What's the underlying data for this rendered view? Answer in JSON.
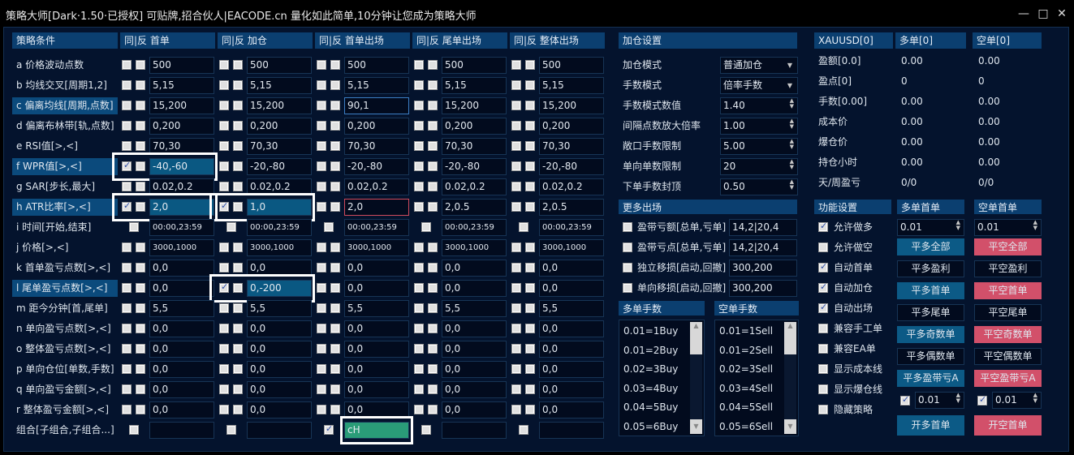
{
  "title": "策略大师[Dark·1.50·已授权]  可贴牌,招合伙人|EACODE.cn  量化如此简单,10分钟让您成为策略大师",
  "window_buttons": {
    "minimize": "—",
    "maximize": "□",
    "close": "✕"
  },
  "grid": {
    "headers": [
      "策略条件",
      "同|反 首单",
      "同|反 加仓",
      "同|反 首单出场",
      "同|反 尾单出场",
      "同|反 整体出场"
    ],
    "rows": [
      {
        "label": "a 价格波动点数",
        "values": [
          "500",
          "500",
          "500",
          "500",
          "500"
        ],
        "checks": [
          "00",
          "00",
          "00",
          "00",
          "00"
        ]
      },
      {
        "label": "b 均线交叉[周期1,2]",
        "values": [
          "5,15",
          "5,15",
          "5,15",
          "5,15",
          "5,15"
        ],
        "checks": [
          "00",
          "00",
          "00",
          "00",
          "00"
        ]
      },
      {
        "label": "c 偏离均线[周期,点数]",
        "hl": true,
        "values": [
          "15,200",
          "15,200",
          "90,1",
          "15,200",
          "15,200"
        ],
        "checks": [
          "00",
          "00",
          "00",
          "00",
          "00"
        ],
        "states": [
          "",
          "",
          "blue",
          "",
          ""
        ]
      },
      {
        "label": "d 偏离布林带[轨,点数]",
        "values": [
          "0,200",
          "0,200",
          "0,200",
          "0,200",
          "0,200"
        ],
        "checks": [
          "00",
          "00",
          "00",
          "00",
          "00"
        ]
      },
      {
        "label": "e RSI值[>,<]",
        "values": [
          "70,30",
          "70,30",
          "70,30",
          "70,30",
          "70,30"
        ],
        "checks": [
          "00",
          "00",
          "00",
          "00",
          "00"
        ]
      },
      {
        "label": "f WPR值[>,<]",
        "hl": true,
        "values": [
          "-40,-60",
          "-20,-80",
          "-20,-80",
          "-20,-80",
          "-20,-80"
        ],
        "checks": [
          "10",
          "00",
          "00",
          "00",
          "00"
        ],
        "states": [
          "selo",
          "",
          "",
          "",
          ""
        ]
      },
      {
        "label": "g SAR[步长,最大]",
        "values": [
          "0.02,0.2",
          "0.02,0.2",
          "0.02,0.2",
          "0.02,0.2",
          "0.02,0.2"
        ],
        "checks": [
          "00",
          "00",
          "00",
          "00",
          "00"
        ]
      },
      {
        "label": "h ATR比率[>,<]",
        "hl": true,
        "values": [
          "2,0",
          "1,0",
          "2,0",
          "2,0.5",
          "2,0.5"
        ],
        "checks": [
          "10",
          "10",
          "00",
          "00",
          "00"
        ],
        "states": [
          "selo",
          "selo",
          "red",
          "",
          ""
        ]
      },
      {
        "label": "i 时间[开始,结束]",
        "single": true,
        "small": true,
        "values": [
          "00:00,23:59",
          "00:00,23:59",
          "00:00,23:59",
          "00:00,23:59",
          "00:00,23:59"
        ],
        "checks": [
          "0",
          "0",
          "0",
          "0",
          "0"
        ]
      },
      {
        "label": "j 价格[>,<]",
        "small": true,
        "values": [
          "3000,1000",
          "3000,1000",
          "3000,1000",
          "3000,1000",
          "3000,1000"
        ],
        "checks": [
          "00",
          "00",
          "00",
          "00",
          "00"
        ]
      },
      {
        "label": "k 首单盈亏点数[>,<]",
        "values": [
          "0,0",
          "0,0",
          "0,0",
          "0,0",
          "0,0"
        ],
        "checks": [
          "00",
          "00",
          "00",
          "00",
          "00"
        ]
      },
      {
        "label": "l 尾单盈亏点数[>,<]",
        "hl": true,
        "values": [
          "0,0",
          "0,-200",
          "0,0",
          "0,0",
          "0,0"
        ],
        "checks": [
          "00",
          "10",
          "00",
          "00",
          "00"
        ],
        "states": [
          "",
          "selo",
          "",
          "",
          ""
        ]
      },
      {
        "label": "m 距今分钟[首,尾单]",
        "values": [
          "5,5",
          "5,5",
          "5,5",
          "5,5",
          "5,5"
        ],
        "checks": [
          "00",
          "00",
          "00",
          "00",
          "00"
        ]
      },
      {
        "label": "n 单向盈亏点数[>,<]",
        "values": [
          "0,0",
          "0,0",
          "0,0",
          "0,0",
          "0,0"
        ],
        "checks": [
          "00",
          "00",
          "00",
          "00",
          "00"
        ]
      },
      {
        "label": "o 整体盈亏点数[>,<]",
        "values": [
          "0,0",
          "0,0",
          "0,0",
          "0,0",
          "0,0"
        ],
        "checks": [
          "00",
          "00",
          "00",
          "00",
          "00"
        ]
      },
      {
        "label": "p 单向仓位[单数,手数]",
        "values": [
          "0,0",
          "0,0",
          "0,0",
          "0,0",
          "0,0"
        ],
        "checks": [
          "00",
          "00",
          "00",
          "00",
          "00"
        ]
      },
      {
        "label": "q 单向盈亏金额[>,<]",
        "values": [
          "0,0",
          "0,0",
          "0,0",
          "0,0",
          "0,0"
        ],
        "checks": [
          "00",
          "00",
          "00",
          "00",
          "00"
        ]
      },
      {
        "label": "r 整体盈亏金额[>,<]",
        "values": [
          "0,0",
          "0,0",
          "0,0",
          "0,0",
          "0,0"
        ],
        "checks": [
          "00",
          "00",
          "00",
          "00",
          "00"
        ]
      },
      {
        "label": "组合[子组合,子组合...]",
        "single": true,
        "values": [
          "",
          "",
          "cH",
          "",
          ""
        ],
        "checks": [
          "0",
          "0",
          "1",
          "0",
          "0"
        ],
        "states": [
          "",
          "",
          "greeno",
          "",
          ""
        ]
      }
    ]
  },
  "add_settings": {
    "header": "加仓设置",
    "rows": [
      {
        "label": "加仓模式",
        "value": "普通加仓",
        "type": "dropdown"
      },
      {
        "label": "手数模式",
        "value": "倍率手数",
        "type": "dropdown"
      },
      {
        "label": "手数模式数值",
        "value": "1.40",
        "type": "spin"
      },
      {
        "label": "间隔点数放大倍率",
        "value": "1.00",
        "type": "spin"
      },
      {
        "label": "敞口手数限制",
        "value": "5.00",
        "type": "spin"
      },
      {
        "label": "单向单数限制",
        "value": "20",
        "type": "spin"
      },
      {
        "label": "下单手数封顶",
        "value": "0.50",
        "type": "spin"
      }
    ]
  },
  "stats": {
    "headers": [
      "XAUUSD[0]",
      "多单[0]",
      "空单[0]"
    ],
    "rows": [
      [
        "盈额[0.0]",
        "0.00",
        "0.00"
      ],
      [
        "盈点[0]",
        "0",
        "0"
      ],
      [
        "手数[0.00]",
        "0.00",
        "0.00"
      ],
      [
        "成本价",
        "0.00",
        "0.00"
      ],
      [
        "爆仓价",
        "0.00",
        "0.00"
      ],
      [
        "持仓小时",
        "0.00",
        "0.00"
      ],
      [
        "天/周盈亏",
        "0/0",
        "0/0"
      ]
    ]
  },
  "more_exit": {
    "header": "更多出场",
    "rows": [
      {
        "label": "盈带亏额[总单,亏单]",
        "value": "14,2|20,4",
        "checked": false
      },
      {
        "label": "盈带亏点[总单,亏单]",
        "value": "14,2|20,4",
        "checked": false
      },
      {
        "label": "独立移损[启动,回撤]",
        "value": "300,200",
        "checked": false
      },
      {
        "label": "单向移损[启动,回撤]",
        "value": "300,200",
        "checked": false
      }
    ]
  },
  "buy_lots": {
    "header": "多单手数",
    "items": [
      "0.01=1Buy",
      "0.01=2Buy",
      "0.02=3Buy",
      "0.03=4Buy",
      "0.04=5Buy",
      "0.05=6Buy"
    ]
  },
  "sell_lots": {
    "header": "空单手数",
    "items": [
      "0.01=1Sell",
      "0.01=2Sell",
      "0.02=3Sell",
      "0.03=4Sell",
      "0.04=5Sell",
      "0.05=6Sell"
    ]
  },
  "features": {
    "header": "功能设置",
    "items": [
      {
        "label": "允许做多",
        "checked": true
      },
      {
        "label": "允许做空",
        "checked": false
      },
      {
        "label": "自动首单",
        "checked": true
      },
      {
        "label": "自动加仓",
        "checked": true
      },
      {
        "label": "自动出场",
        "checked": true
      },
      {
        "label": "兼容手工单",
        "checked": false
      },
      {
        "label": "兼容EA单",
        "checked": false
      },
      {
        "label": "显示成本线",
        "checked": false
      },
      {
        "label": "显示爆仓线",
        "checked": false
      },
      {
        "label": "隐藏策略",
        "checked": false
      }
    ]
  },
  "buy_panel": {
    "header": "多单首单",
    "lot": "0.01",
    "buttons": [
      {
        "label": "平多全部",
        "style": "blue"
      },
      {
        "label": "平多盈利",
        "style": "dark"
      },
      {
        "label": "平多首单",
        "style": "blue"
      },
      {
        "label": "平多尾单",
        "style": "dark"
      },
      {
        "label": "平多奇数单",
        "style": "blue"
      },
      {
        "label": "平多偶数单",
        "style": "dark"
      },
      {
        "label": "平多盈带亏A",
        "style": "blue"
      }
    ],
    "lot2_checked": true,
    "lot2": "0.01",
    "open": "开多首单"
  },
  "sell_panel": {
    "header": "空单首单",
    "lot": "0.01",
    "buttons": [
      {
        "label": "平空全部",
        "style": "red"
      },
      {
        "label": "平空盈利",
        "style": "dark"
      },
      {
        "label": "平空首单",
        "style": "red"
      },
      {
        "label": "平空尾单",
        "style": "dark"
      },
      {
        "label": "平空奇数单",
        "style": "red"
      },
      {
        "label": "平空偶数单",
        "style": "dark"
      },
      {
        "label": "平空盈带亏A",
        "style": "red"
      }
    ],
    "lot2_checked": true,
    "lot2": "0.01",
    "open": "开空首单"
  },
  "colors": {
    "bg": "#04132d",
    "header": "#0b3f70",
    "buy": "#0c5a86",
    "sell": "#d2506a",
    "combo": "#2a9c78"
  }
}
